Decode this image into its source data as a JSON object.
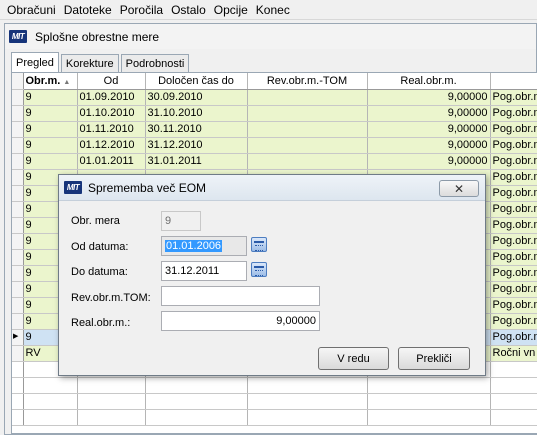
{
  "menu": [
    "Obračuni",
    "Datoteke",
    "Poročila",
    "Ostalo",
    "Opcije",
    "Konec"
  ],
  "window": {
    "logo": "MIT",
    "title": "Splošne obrestne mere"
  },
  "tabs": [
    "Pregled",
    "Korekture",
    "Podrobnosti"
  ],
  "grid": {
    "columns": [
      "Obr.m.",
      "Od",
      "Določen čas do",
      "Rev.obr.m.-TOM",
      "Real.obr.m.",
      ""
    ],
    "rows": [
      [
        "9",
        "01.09.2010",
        "30.09.2010",
        "",
        "9,00000",
        "Pog.obr.m"
      ],
      [
        "9",
        "01.10.2010",
        "31.10.2010",
        "",
        "9,00000",
        "Pog.obr.m"
      ],
      [
        "9",
        "01.11.2010",
        "30.11.2010",
        "",
        "9,00000",
        "Pog.obr.m"
      ],
      [
        "9",
        "01.12.2010",
        "31.12.2010",
        "",
        "9,00000",
        "Pog.obr.m"
      ],
      [
        "9",
        "01.01.2011",
        "31.01.2011",
        "",
        "9,00000",
        "Pog.obr.m"
      ],
      [
        "9",
        "",
        "",
        "",
        "",
        "Pog.obr.m"
      ],
      [
        "9",
        "",
        "",
        "",
        "",
        "Pog.obr.m"
      ],
      [
        "9",
        "",
        "",
        "",
        "",
        "Pog.obr.m"
      ],
      [
        "9",
        "",
        "",
        "",
        "",
        "Pog.obr.m"
      ],
      [
        "9",
        "",
        "",
        "",
        "",
        "Pog.obr.m"
      ],
      [
        "9",
        "",
        "",
        "",
        "",
        "Pog.obr.m"
      ],
      [
        "9",
        "",
        "",
        "",
        "",
        "Pog.obr.m"
      ],
      [
        "9",
        "",
        "",
        "",
        "",
        "Pog.obr.m"
      ],
      [
        "9",
        "",
        "",
        "",
        "",
        "Pog.obr.m"
      ],
      [
        "9",
        "",
        "",
        "",
        "",
        "Pog.obr.m"
      ],
      [
        "9",
        "",
        "",
        "",
        "",
        "Pog.obr.m"
      ],
      [
        "RV",
        "",
        "",
        "",
        "",
        "Ročni vn"
      ]
    ],
    "current_row": 15
  },
  "dialog": {
    "logo": "MIT",
    "title": "Sprememba več EOM",
    "close_symbol": "✕",
    "obr_mera_label": "Obr. mera",
    "obr_mera_value": "9",
    "od_label": "Od datuma:",
    "od_value": "01.01.2006",
    "do_label": "Do datuma:",
    "do_value": "31.12.2011",
    "rev_label": "Rev.obr.m.TOM:",
    "rev_value": "",
    "real_label": "Real.obr.m.:",
    "real_value": "9,00000",
    "ok_label": "V redu",
    "cancel_label": "Prekliči"
  }
}
